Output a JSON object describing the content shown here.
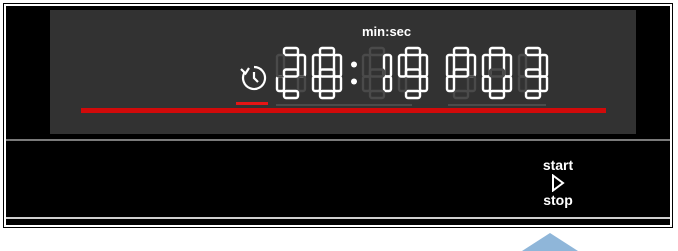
{
  "display": {
    "unit_label": "min:sec",
    "time_value": "28:19",
    "program_value": "P03",
    "indicator_color": "#d10a0a",
    "icons": {
      "timer": "timer-icon"
    }
  },
  "controls": {
    "start_label": "start",
    "stop_label": "stop",
    "icon": "play-icon"
  },
  "pointer": {
    "icon": "arrow-up-icon",
    "color": "#8fb6d9"
  }
}
